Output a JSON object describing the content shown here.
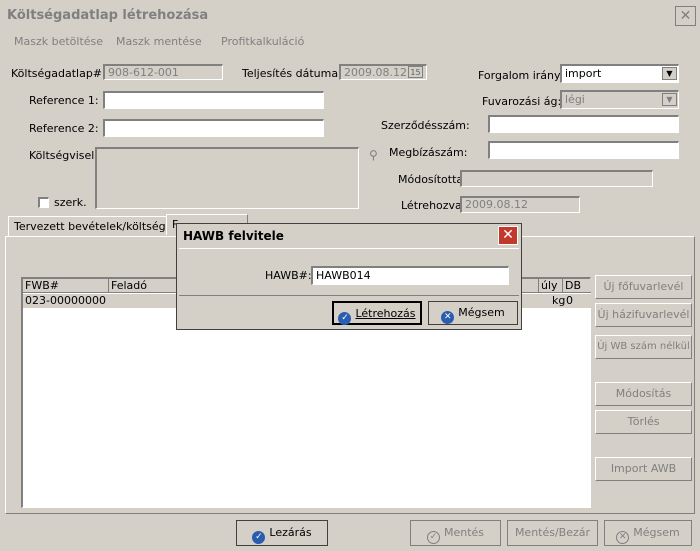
{
  "window": {
    "title": "Költségadatlap létrehozása",
    "close_glyph": "✕"
  },
  "menu": {
    "items": [
      "Maszk betöltése",
      "Maszk mentése",
      "Profitkalkuláció"
    ]
  },
  "form": {
    "koltsegadatlap_label": "Költségadatlap#:",
    "koltsegadatlap_value": "908-612-001",
    "teljesites_label": "Teljesítés dátuma:",
    "teljesites_value": "2009.08.12",
    "calendar_glyph": "15",
    "forgalom_label": "Forgalom irány:",
    "forgalom_value": "import",
    "reference1_label": "Reference 1:",
    "reference1_value": "",
    "fuvarozasi_label": "Fuvarozási ág:",
    "fuvarozasi_value": "légi",
    "reference2_label": "Reference 2:",
    "reference2_value": "",
    "szerzodes_label": "Szerződésszám:",
    "szerzodes_value": "",
    "koltsegviselo_label": "Költségviselő",
    "megbizas_label": "Megbízászám:",
    "megbizas_value": "",
    "modositotta_label": "Módosította:",
    "modositotta_value": "",
    "szerk_label": "szerk.",
    "letrehozva_label": "Létrehozva:",
    "letrehozva_value": "2009.08.12"
  },
  "tabs": [
    "Tervezett bevételek/költségek",
    "F"
  ],
  "grid": {
    "columns": [
      "FWB#",
      "Feladó",
      "úly",
      "DB"
    ],
    "rows": [
      {
        "fwb": "023-00000000",
        "weight": "kg",
        "db": "0"
      }
    ]
  },
  "side_buttons": [
    "Új főfuvarlevél",
    "Új házifuvarlevél",
    "Új WB szám nélkül",
    "Módosítás",
    "Törlés",
    "Import AWB"
  ],
  "bottom_buttons": {
    "lezaras": "Lezárás",
    "mentes": "Mentés",
    "mentes_bezar": "Mentés/Bezár",
    "megsem": "Mégsem"
  },
  "dialog": {
    "title": "HAWB felvitele",
    "field_label": "HAWB#:",
    "field_value": "HAWB014",
    "create_label": "Létrehozás",
    "cancel_label": "Mégsem"
  },
  "colors": {
    "accent_blue": "#2a5db0",
    "close_red": "#c0392b"
  }
}
